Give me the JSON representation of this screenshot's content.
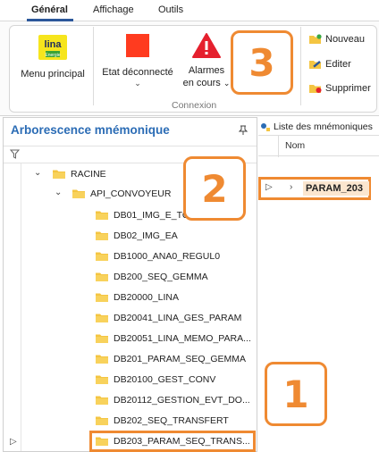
{
  "ribbon": {
    "tabs": [
      "Général",
      "Affichage",
      "Outils"
    ],
    "buttons": {
      "menu_principal": "Menu principal",
      "etat": "Etat déconnecté",
      "alarmes_line1": "Alarmes",
      "alarmes_line2": "en cours",
      "nouveau": "Nouveau",
      "editer": "Editer",
      "supprimer": "Supprimer"
    },
    "group_label": "Connexion",
    "lina_logo_text": "lina",
    "lina_logo_sub": "Energie"
  },
  "tree_panel": {
    "title": "Arborescence mnémonique",
    "root": "RACINE",
    "child": "API_CONVOYEUR",
    "items": [
      "DB01_IMG_E_TO",
      "DB02_IMG_EA",
      "DB1000_ANA0_REGUL0",
      "DB200_SEQ_GEMMA",
      "DB20000_LINA",
      "DB20041_LINA_GES_PARAM",
      "DB20051_LINA_MEMO_PARA...",
      "DB201_PARAM_SEQ_GEMMA",
      "DB20100_GEST_CONV",
      "DB20112_GESTION_EVT_DO...",
      "DB202_SEQ_TRANSFERT",
      "DB203_PARAM_SEQ_TRANS..."
    ]
  },
  "list_panel": {
    "tab_label": "Liste des mnémoniques",
    "column_nom": "Nom",
    "row_name": "PARAM_203"
  },
  "callouts": [
    "1",
    "2",
    "3"
  ],
  "colors": {
    "accent_blue": "#2b6cb5",
    "highlight_orange": "#ef8a32",
    "alarm_red": "#e5202e",
    "stop_red": "#ff3b1f",
    "folder_yellow": "#f4c542"
  }
}
